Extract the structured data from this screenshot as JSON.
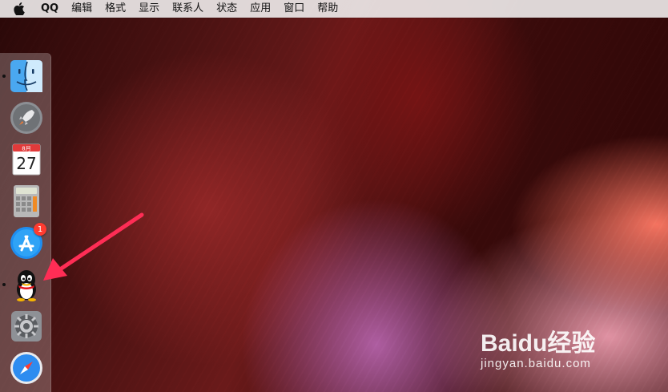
{
  "menubar": {
    "app_name": "QQ",
    "items": [
      "编辑",
      "格式",
      "显示",
      "联系人",
      "状态",
      "应用",
      "窗口",
      "帮助"
    ]
  },
  "dock": {
    "items": [
      {
        "name": "finder",
        "running": true
      },
      {
        "name": "launchpad",
        "running": false
      },
      {
        "name": "calendar",
        "running": false,
        "month": "8月",
        "day": "27"
      },
      {
        "name": "calculator",
        "running": false
      },
      {
        "name": "app-store",
        "running": false,
        "badge": "1"
      },
      {
        "name": "qq",
        "running": true
      },
      {
        "name": "system-preferences",
        "running": false
      },
      {
        "name": "safari",
        "running": false
      }
    ]
  },
  "colors": {
    "menubar_bg": "#ebe8e8",
    "badge": "#ff3b30",
    "arrow": "#ff2d55"
  },
  "watermark": {
    "brand": "Baidu经验",
    "url": "jingyan.baidu.com"
  }
}
